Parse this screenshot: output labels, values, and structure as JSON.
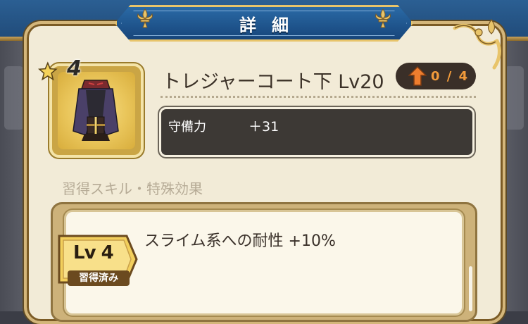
{
  "header": {
    "title": "詳細"
  },
  "item": {
    "rank": "4",
    "name": "トレジャーコート下 Lv20",
    "upgrade_count": "0 / 4",
    "stats": [
      {
        "label": "守備力",
        "value": "＋31"
      }
    ]
  },
  "skills": {
    "heading": "習得スキル・特殊効果",
    "entries": [
      {
        "level": "Lv 4",
        "status": "習得済み",
        "text": "スライム系への耐性 +10%"
      }
    ]
  },
  "colors": {
    "header_blue": "#1f5a96",
    "gold": "#e8c46a",
    "panel": "#f2ebd7",
    "stat_box": "#3d3935",
    "upgrade_orange": "#f29b3b"
  },
  "icons": [
    "fleur-de-lis-icon",
    "corner-ornament-icon",
    "star-icon",
    "up-arrow-icon",
    "item-coat-icon"
  ]
}
